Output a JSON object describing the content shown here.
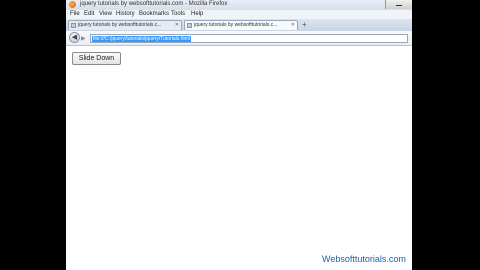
{
  "window": {
    "title": "jquery tutorials by websofttutorials.com - Mozilla Firefox"
  },
  "menu": {
    "items": [
      "File",
      "Edit",
      "View",
      "History",
      "Bookmarks",
      "Tools",
      "Help"
    ]
  },
  "tabs": [
    {
      "label": "jquery tutorials by websofttutorials.c..."
    },
    {
      "label": "jquery tutorials by websofttutorials.c..."
    }
  ],
  "newtab": {
    "label": "+"
  },
  "nav": {
    "back_glyph": "◀",
    "forward_glyph": "▶"
  },
  "address": {
    "url": "file:///C:/jquery/tutorials/jquery/Tutorials.html"
  },
  "content": {
    "slide_button": "Slide Down"
  },
  "watermark": {
    "text": "Websofttutorials.com"
  }
}
